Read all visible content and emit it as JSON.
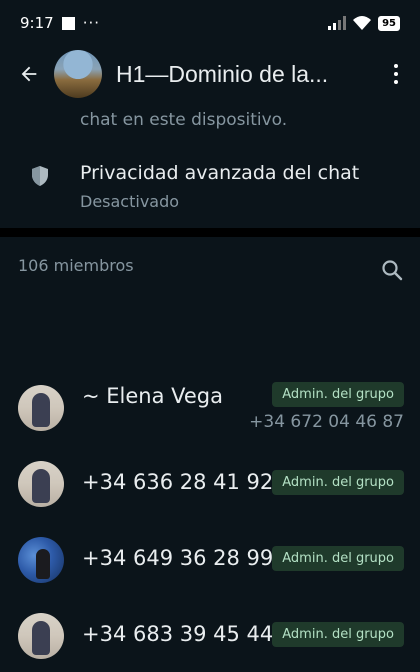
{
  "status_bar": {
    "time": "9:17",
    "dots": "···",
    "battery": "95"
  },
  "header": {
    "title": "H1—Dominio de la..."
  },
  "encryption": {
    "text": "chat en este dispositivo."
  },
  "privacy": {
    "title": "Privacidad avanzada del chat",
    "subtitle": "Desactivado"
  },
  "members": {
    "count_label": "106 miembros",
    "list": [
      {
        "name": "~ Elena Vega",
        "phone": "+34 672 04 46 87",
        "badge": "Admin. del grupo"
      },
      {
        "name": "+34 636 28 41 92",
        "badge": "Admin. del grupo"
      },
      {
        "name": "+34 649 36 28 99",
        "badge": "Admin. del grupo"
      },
      {
        "name": "+34 683 39 45 44",
        "badge": "Admin. del grupo"
      }
    ]
  }
}
